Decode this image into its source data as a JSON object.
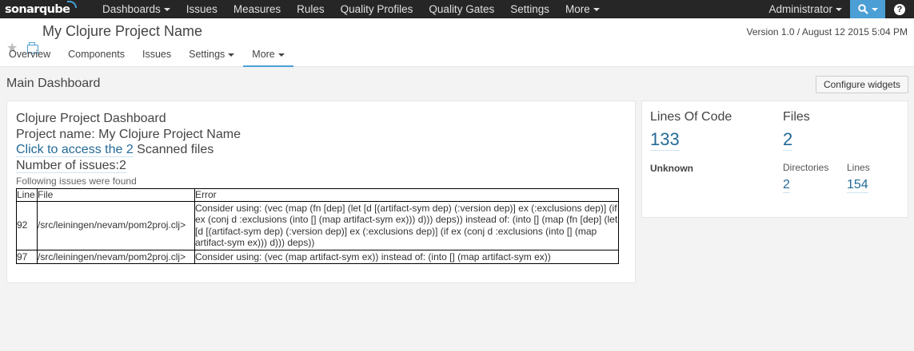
{
  "topnav": {
    "logo": "sonarqube",
    "items": [
      {
        "label": "Dashboards",
        "caret": true
      },
      {
        "label": "Issues",
        "caret": false
      },
      {
        "label": "Measures",
        "caret": false
      },
      {
        "label": "Rules",
        "caret": false
      },
      {
        "label": "Quality Profiles",
        "caret": false
      },
      {
        "label": "Quality Gates",
        "caret": false
      },
      {
        "label": "Settings",
        "caret": false
      },
      {
        "label": "More",
        "caret": true
      }
    ],
    "user": "Administrator",
    "search_icon": "search-icon",
    "help_icon": "help-icon",
    "help_glyph": "?"
  },
  "context": {
    "project_name": "My Clojure Project Name",
    "version": "Version 1.0 / August 12 2015 5:04 PM",
    "tabs": [
      {
        "label": "Overview",
        "caret": false
      },
      {
        "label": "Components",
        "caret": false
      },
      {
        "label": "Issues",
        "caret": false
      },
      {
        "label": "Settings",
        "caret": true
      },
      {
        "label": "More",
        "caret": true
      }
    ]
  },
  "page": {
    "title": "Main Dashboard",
    "configure_label": "Configure widgets"
  },
  "dashboard_widget": {
    "title": "Clojure Project Dashboard",
    "project_line": "Project name: My Clojure Project Name",
    "access_link": "Click to access the 2",
    "access_suffix": " Scanned files",
    "issues_line": "Number of issues:2",
    "found_text": "Following issues were found",
    "columns": [
      "Line",
      "File",
      "Error"
    ],
    "rows": [
      {
        "line": "92",
        "file": "/src/leiningen/nevam/pom2proj.clj>",
        "error": "Consider using: (vec (map (fn [dep] (let [d [(artifact-sym dep) (:version dep)] ex (:exclusions dep)] (if ex (conj d :exclusions (into [] (map artifact-sym ex))) d))) deps)) instead of: (into [] (map (fn [dep] (let [d [(artifact-sym dep) (:version dep)] ex (:exclusions dep)] (if ex (conj d :exclusions (into [] (map artifact-sym ex))) d))) deps))"
      },
      {
        "line": "97",
        "file": "/src/leiningen/nevam/pom2proj.clj>",
        "error": "Consider using: (vec (map artifact-sym ex)) instead of: (into [] (map artifact-sym ex))"
      }
    ]
  },
  "metrics": {
    "loc_label": "Lines Of Code",
    "loc_value": "133",
    "files_label": "Files",
    "files_value": "2",
    "unknown_label": "Unknown",
    "dirs_label": "Directories",
    "dirs_value": "2",
    "lines_label": "Lines",
    "lines_value": "154"
  },
  "colors": {
    "nav_bg": "#262626",
    "accent": "#4b9fd5",
    "link": "#236a97"
  }
}
